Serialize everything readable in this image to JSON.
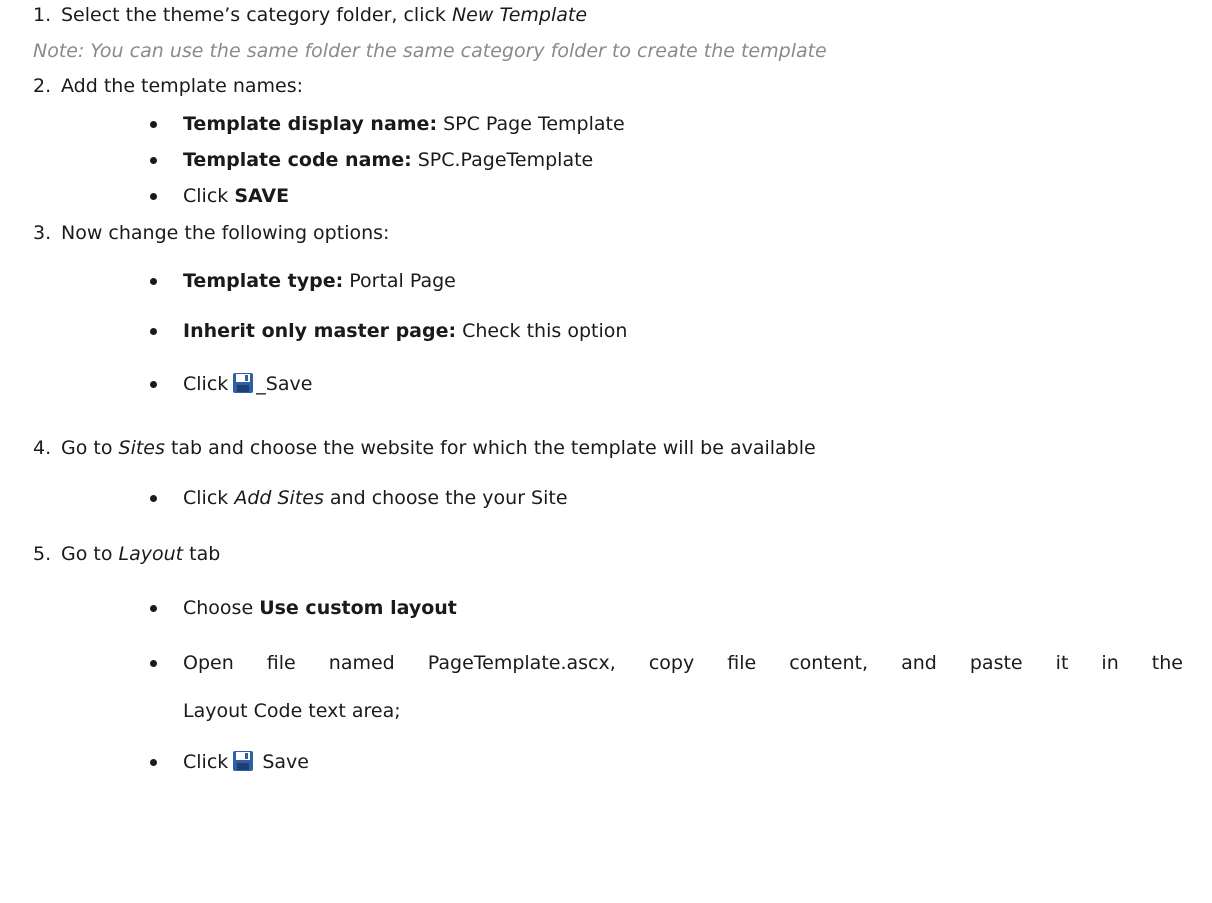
{
  "header": {
    "title": ""
  },
  "steps": {
    "s1": {
      "num": "1.",
      "text_a": "Select the theme’s category folder, click ",
      "text_b": "New Template"
    },
    "note": "Note: You can use the same folder the same category folder to create the template",
    "s2": {
      "num": "2.",
      "text": "Add the template names:",
      "b1_label": "Template display name:",
      "b1_value": " SPC Page Template",
      "b2_label": "Template code name:",
      "b2_value": " SPC.PageTemplate",
      "b3_text": "Click ",
      "b3_bold": "SAVE"
    },
    "s3": {
      "num": "3.",
      "text": "Now change the following options:",
      "b1_label": "Template type:",
      "b1_value": " Portal Page",
      "b2_label": "Inherit only master page:",
      "b2_value": " Check this option",
      "b3_text": "Click",
      "b3_after": "_Save"
    },
    "s4": {
      "num": "4.",
      "text_a": "Go to ",
      "text_i": "Sites",
      "text_b": " tab and choose the website for which the template will be available",
      "b1_text_a": "Click ",
      "b1_i": "Add Sites",
      "b1_text_b": " and choose the your Site"
    },
    "s5": {
      "num": "5.",
      "text_a": "Go to ",
      "text_i": "Layout",
      "text_b": " tab",
      "b1_text": "Choose ",
      "b1_bold": "Use custom layout",
      "b2_line1": "Open file named PageTemplate.ascx, copy file content, and paste it in the",
      "b2_line2": "Layout Code text area;",
      "b3_text": "Click",
      "b3_after": " Save"
    }
  },
  "icons": {
    "save": "floppy-disk-save-icon"
  },
  "colors": {
    "heading": "#e8731f",
    "note": "#8a8a8a",
    "text": "#1a1a1a",
    "icon_blue": "#2f5fa8"
  }
}
